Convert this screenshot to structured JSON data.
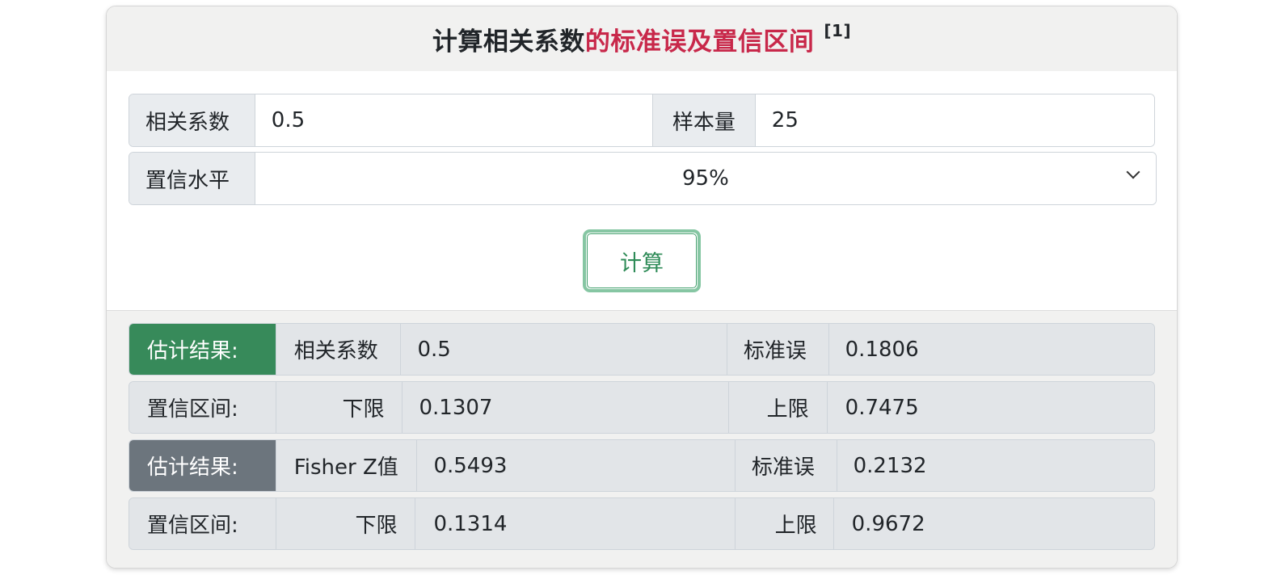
{
  "header": {
    "title_part1": "计算相关系数",
    "title_part2": "的标准误及置信区间",
    "ref": "[1]"
  },
  "inputs": {
    "corr_label": "相关系数",
    "corr_value": "0.5",
    "n_label": "样本量",
    "n_value": "25",
    "conf_label": "置信水平",
    "conf_value": "95%"
  },
  "button": {
    "label": "计算"
  },
  "colors": {
    "title_accent": "#c8284a",
    "button_border": "#86c6a3",
    "button_text": "#2e8b57",
    "result_green": "#378a5a",
    "result_gray": "#6c757d"
  },
  "results": {
    "r1": {
      "badge": "估计结果:",
      "label1": "相关系数",
      "value1": "0.5",
      "label2": "标准误",
      "value2": "0.1806"
    },
    "r2": {
      "label": "置信区间:",
      "lower_label": "下限",
      "lower": "0.1307",
      "upper_label": "上限",
      "upper": "0.7475"
    },
    "r3": {
      "badge": "估计结果:",
      "label1": "Fisher Z值",
      "value1": "0.5493",
      "label2": "标准误",
      "value2": "0.2132"
    },
    "r4": {
      "label": "置信区间:",
      "lower_label": "下限",
      "lower": "0.1314",
      "upper_label": "上限",
      "upper": "0.9672"
    }
  }
}
